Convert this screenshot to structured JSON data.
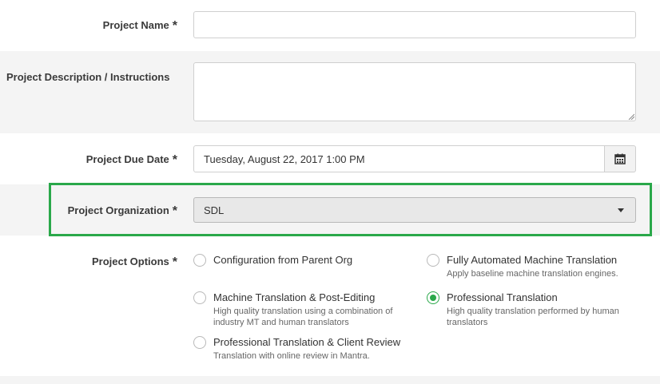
{
  "form": {
    "project_name": {
      "label": "Project Name",
      "required_mark": "*",
      "value": ""
    },
    "project_description": {
      "label": "Project Description / Instructions",
      "value": ""
    },
    "project_due_date": {
      "label": "Project Due Date",
      "required_mark": "*",
      "value": "Tuesday, August 22, 2017 1:00 PM",
      "icon": "calendar-icon"
    },
    "project_organization": {
      "label": "Project Organization",
      "required_mark": "*",
      "selected": "SDL",
      "highlight_color": "#2aa84a"
    },
    "project_options": {
      "label": "Project Options",
      "required_mark": "*",
      "options": [
        {
          "title": "Configuration from Parent Org",
          "desc": "",
          "checked": false
        },
        {
          "title": "Fully Automated Machine Translation",
          "desc": "Apply baseline machine translation engines.",
          "checked": false
        },
        {
          "title": "Machine Translation & Post-Editing",
          "desc": "High quality translation using a combination of industry MT and human translators",
          "checked": false
        },
        {
          "title": "Professional Translation",
          "desc": "High quality translation performed by human translators",
          "checked": true
        },
        {
          "title": "Professional Translation & Client Review",
          "desc": "Translation with online review in Mantra.",
          "checked": false
        }
      ]
    }
  }
}
